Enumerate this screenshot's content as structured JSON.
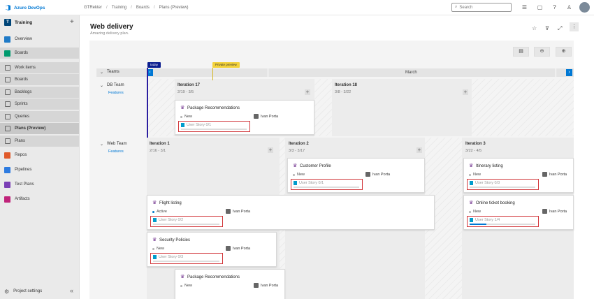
{
  "topbar": {
    "brand": "Azure DevOps",
    "breadcrumbs": [
      "GTRekter",
      "Training",
      "Boards",
      "Plans (Preview)"
    ],
    "search_placeholder": "Search"
  },
  "sidebar": {
    "project_badge": "T",
    "project_name": "Training",
    "items": [
      {
        "label": "Overview",
        "icon": "overview-icon",
        "color": "#1f7ac7"
      },
      {
        "label": "Boards",
        "icon": "boards-icon",
        "color": "#009a6e"
      },
      {
        "label": "Work items",
        "icon": "work-items-icon"
      },
      {
        "label": "Boards",
        "icon": "boards-sub-icon"
      },
      {
        "label": "Backlogs",
        "icon": "backlogs-icon"
      },
      {
        "label": "Sprints",
        "icon": "sprints-icon"
      },
      {
        "label": "Queries",
        "icon": "queries-icon"
      },
      {
        "label": "Plans (Preview)",
        "icon": "plans-icon"
      },
      {
        "label": "Plans",
        "icon": "plans-icon"
      },
      {
        "label": "Repos",
        "icon": "repos-icon",
        "color": "#e05a2a"
      },
      {
        "label": "Pipelines",
        "icon": "pipelines-icon",
        "color": "#2d7be0"
      },
      {
        "label": "Test Plans",
        "icon": "test-plans-icon",
        "color": "#7a3fb5"
      },
      {
        "label": "Artifacts",
        "icon": "artifacts-icon",
        "color": "#c0237a"
      }
    ],
    "settings": "Project settings"
  },
  "header": {
    "title": "Web delivery",
    "subtitle": "Amazing delivery plan."
  },
  "timeline": {
    "teams_label": "Teams",
    "month": "March",
    "today_marker": "today",
    "milestone_marker": "Private preview"
  },
  "teams": [
    {
      "name": "DB Team",
      "link": "Features",
      "iterations": [
        {
          "title": "Iteration 17",
          "dates": "2/19 - 3/5"
        },
        {
          "title": "Iteration 18",
          "dates": "3/8 - 3/22"
        }
      ],
      "cards": [
        {
          "title": "Package Recommendations",
          "state": "New",
          "state_color": "#b2b2b2",
          "assignee": "Ivan Porta",
          "progress_text": "User Story 0/1",
          "progress": 0
        }
      ]
    },
    {
      "name": "Web Team",
      "link": "Features",
      "iterations": [
        {
          "title": "Iteration 1",
          "dates": "2/16 - 3/1"
        },
        {
          "title": "Iteration 2",
          "dates": "3/3 - 3/17"
        },
        {
          "title": "Iteration 3",
          "dates": "3/22 - 4/5"
        }
      ],
      "cards": [
        {
          "title": "Customer Profile",
          "state": "New",
          "state_color": "#b2b2b2",
          "assignee": "Ivan Porta",
          "progress_text": "User Story 0/1",
          "progress": 0
        },
        {
          "title": "Itinerary listing",
          "state": "New",
          "state_color": "#b2b2b2",
          "assignee": "Ivan Porta",
          "progress_text": "User Story 0/3",
          "progress": 0
        },
        {
          "title": "Flight listing",
          "state": "Active",
          "state_color": "#007acc",
          "assignee": "Ivan Porta",
          "progress_text": "User Story 0/2",
          "progress": 0
        },
        {
          "title": "Online ticket booking",
          "state": "New",
          "state_color": "#b2b2b2",
          "assignee": "Ivan Porta",
          "progress_text": "User Story 1/4",
          "progress": 0.25
        },
        {
          "title": "Security Policies",
          "state": "New",
          "state_color": "#b2b2b2",
          "assignee": "Ivan Porta",
          "progress_text": "User Story 0/3",
          "progress": 0
        },
        {
          "title": "Package Recommendations",
          "state": "New",
          "state_color": "#b2b2b2",
          "assignee": "Ivan Porta"
        }
      ]
    }
  ]
}
